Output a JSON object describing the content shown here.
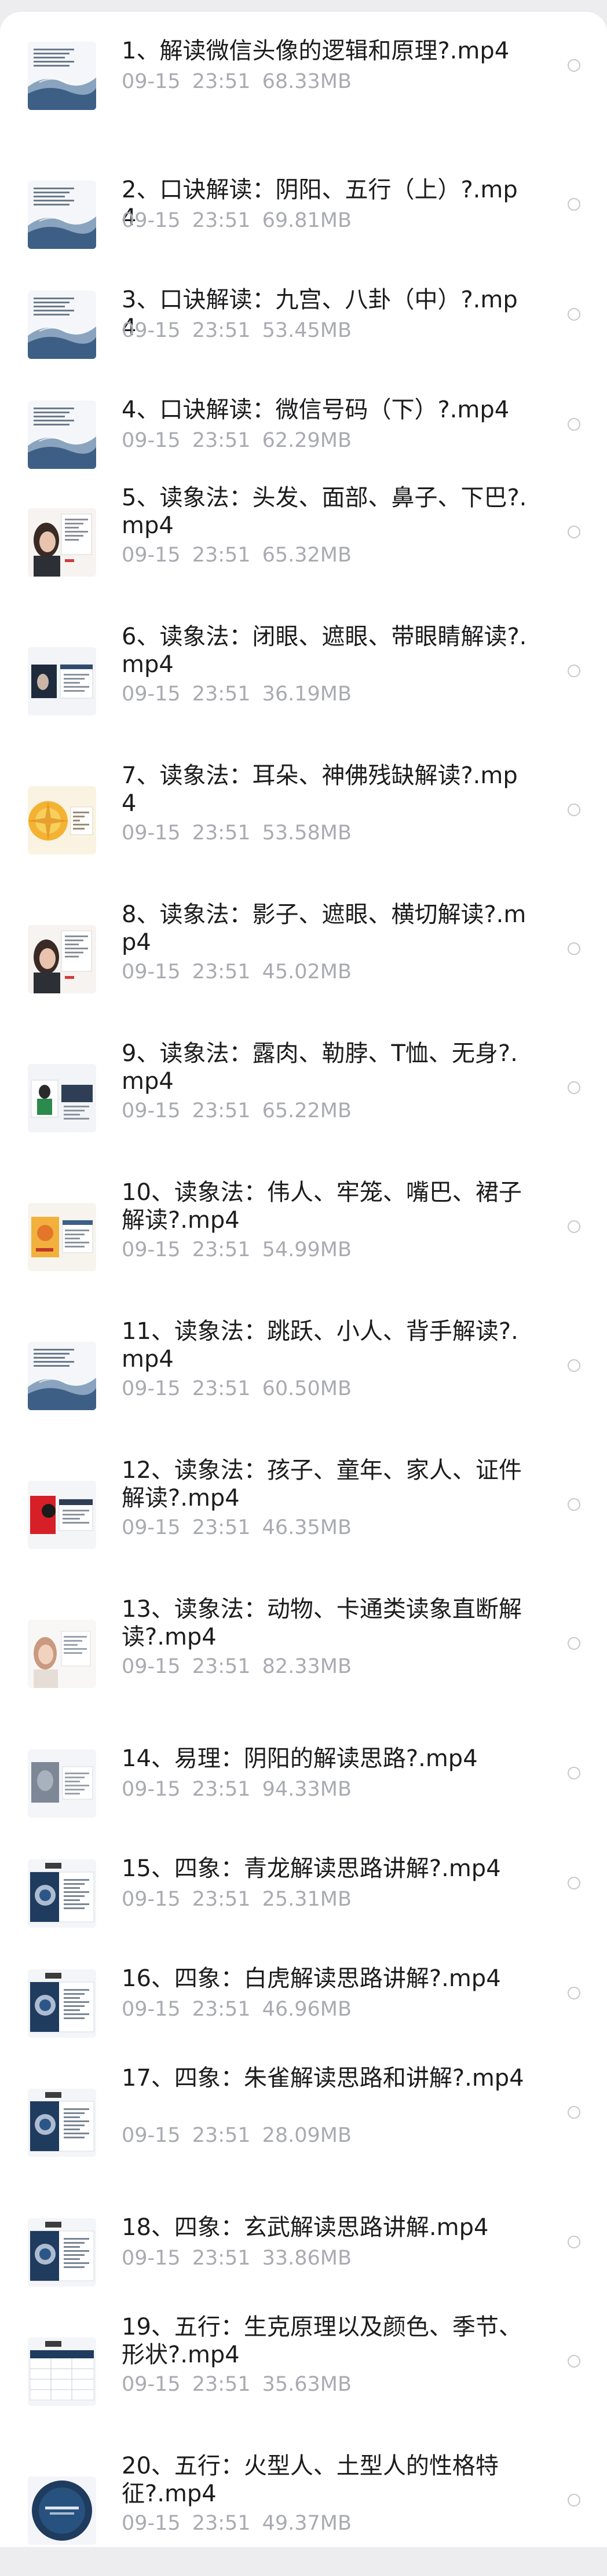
{
  "files": [
    {
      "title": "1、解读微信头像的逻辑和原理?.mp4",
      "date": "09-15",
      "time": "23:51",
      "size": "68.33MB",
      "thumb": "doc-wave",
      "lines": 1
    },
    {
      "title": "2、口诀解读：阴阳、五行（上）?.mp4",
      "date": "09-15",
      "time": "23:51",
      "size": "69.81MB",
      "thumb": "doc-wave",
      "lines": 1
    },
    {
      "title": "3、口诀解读：九宫、八卦（中）?.mp4",
      "date": "09-15",
      "time": "23:51",
      "size": "53.45MB",
      "thumb": "doc-wave",
      "lines": 1
    },
    {
      "title": "4、口诀解读：微信号码（下）?.mp4",
      "date": "09-15",
      "time": "23:51",
      "size": "62.29MB",
      "thumb": "doc-wave",
      "lines": 1
    },
    {
      "title": "5、读象法：头发、面部、鼻子、下巴?.mp4",
      "date": "09-15",
      "time": "23:51",
      "size": "65.32MB",
      "thumb": "portrait",
      "lines": 2
    },
    {
      "title": "6、读象法：闭眼、遮眼、带眼睛解读?.mp4",
      "date": "09-15",
      "time": "23:51",
      "size": "36.19MB",
      "thumb": "slide-dark",
      "lines": 2
    },
    {
      "title": "7、读象法：耳朵、神佛残缺解读?.mp4",
      "date": "09-15",
      "time": "23:51",
      "size": "53.58MB",
      "thumb": "golden",
      "lines": 2
    },
    {
      "title": "8、读象法：影子、遮眼、横切解读?.mp4",
      "date": "09-15",
      "time": "23:51",
      "size": "45.02MB",
      "thumb": "portrait",
      "lines": 2
    },
    {
      "title": "9、读象法：露肉、勒脖、T恤、无身?.mp4",
      "date": "09-15",
      "time": "23:51",
      "size": "65.22MB",
      "thumb": "slide-green",
      "lines": 2
    },
    {
      "title": "10、读象法：伟人、牢笼、嘴巴、裙子解读?.mp4",
      "date": "09-15",
      "time": "23:51",
      "size": "54.99MB",
      "thumb": "golden-slide",
      "lines": 2
    },
    {
      "title": "11、读象法：跳跃、小人、背手解读?.mp4",
      "date": "09-15",
      "time": "23:51",
      "size": "60.50MB",
      "thumb": "doc-wave",
      "lines": 2
    },
    {
      "title": "12、读象法：孩子、童年、家人、证件解读?.mp4",
      "date": "09-15",
      "time": "23:51",
      "size": "46.35MB",
      "thumb": "red-slide",
      "lines": 2
    },
    {
      "title": "13、读象法：动物、卡通类读象直断解读?.mp4",
      "date": "09-15",
      "time": "23:51",
      "size": "82.33MB",
      "thumb": "portrait-light",
      "lines": 2
    },
    {
      "title": "14、易理：阴阳的解读思路?.mp4",
      "date": "09-15",
      "time": "23:51",
      "size": "94.33MB",
      "thumb": "slide-plain",
      "lines": 1
    },
    {
      "title": "15、四象：青龙解读思路讲解?.mp4",
      "date": "09-15",
      "time": "23:51",
      "size": "25.31MB",
      "thumb": "slide-navy",
      "lines": 1
    },
    {
      "title": "16、四象：白虎解读思路讲解?.mp4",
      "date": "09-15",
      "time": "23:51",
      "size": "46.96MB",
      "thumb": "slide-navy",
      "lines": 1
    },
    {
      "title": "17、四象：朱雀解读思路和讲解?.mp4",
      "date": "09-15",
      "time": "23:51",
      "size": "28.09MB",
      "thumb": "slide-navy",
      "lines": 2
    },
    {
      "title": "18、四象：玄武解读思路讲解.mp4",
      "date": "09-15",
      "time": "23:51",
      "size": "33.86MB",
      "thumb": "slide-navy",
      "lines": 1
    },
    {
      "title": "19、五行：生克原理以及颜色、季节、形状?.mp4",
      "date": "09-15",
      "time": "23:51",
      "size": "35.63MB",
      "thumb": "table-navy",
      "lines": 2
    },
    {
      "title": "20、五行：火型人、土型人的性格特征?.mp4",
      "date": "09-15",
      "time": "23:51",
      "size": "49.37MB",
      "thumb": "circle-navy",
      "lines": 2
    }
  ],
  "colors": {
    "title": "#1c1c1e",
    "meta": "#a9abb1",
    "radio_border": "#c6c8cd",
    "background": "#ededf0"
  }
}
